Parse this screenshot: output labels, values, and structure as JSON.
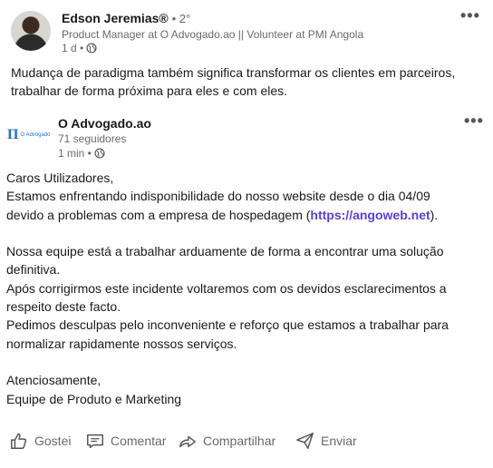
{
  "author": {
    "name": "Edson Jeremias®",
    "degree": "• 2°",
    "headline": "Product Manager at O Advogado.ao || Volunteer at PMI Angola",
    "time": "1 d •"
  },
  "post": {
    "text_line1": "Mudança de paradigma também significa transformar os clientes em parceiros,",
    "text_line2": "trabalhar de forma próxima para eles e com eles."
  },
  "shared": {
    "logo_text": "O Advogado",
    "name": "O Advogado.ao",
    "followers": "71 seguidores",
    "time": "1 min •",
    "line1": "Caros Utilizadores,",
    "line2": "Estamos enfrentando indisponibilidade do nosso website desde o dia 04/09",
    "line3_pre": "devido a problemas com a empresa de hospedagem (",
    "line3_link": "https://angoweb.net",
    "line3_post": ").",
    "line4": "Nossa equipe está a trabalhar arduamente de forma a encontrar uma solução",
    "line5": "definitiva.",
    "line6": "Após corrigirmos este incidente voltaremos com os devidos esclarecimentos a",
    "line7": "respeito deste facto.",
    "line8": "Pedimos desculpas pelo inconveniente e reforço que estamos a trabalhar para",
    "line9": "normalizar rapidamente nossos serviços.",
    "line10": "Atenciosamente,",
    "line11": "Equipe de Produto e Marketing"
  },
  "actions": {
    "like": "Gostei",
    "comment": "Comentar",
    "share": "Compartilhar",
    "send": "Enviar"
  },
  "more_glyph": "•••",
  "colors": {
    "link": "#5b3fd6",
    "muted": "rgba(0,0,0,0.6)",
    "logo": "#1f6fd0"
  }
}
